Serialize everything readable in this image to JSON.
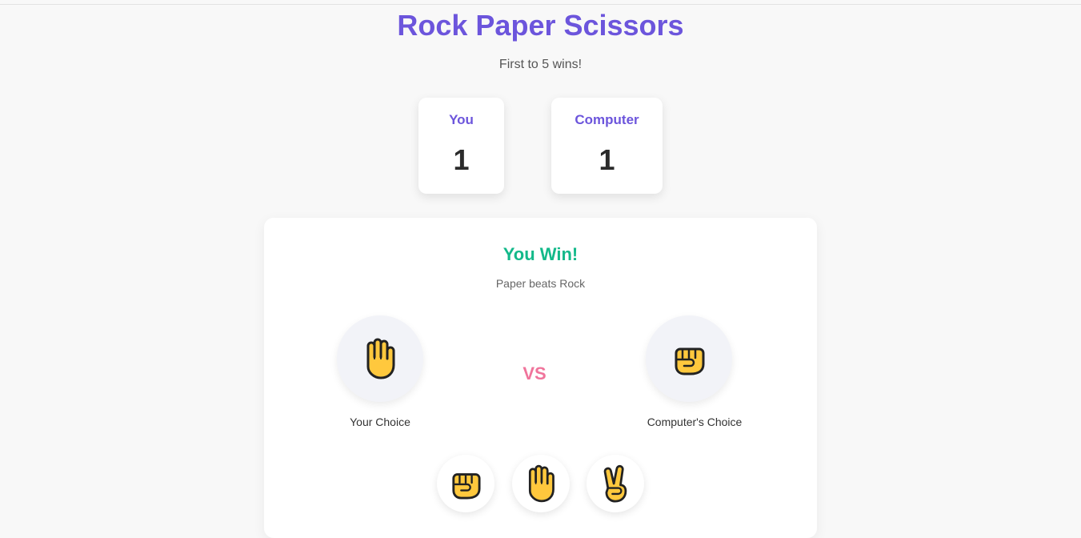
{
  "header": {
    "title": "Rock Paper Scissors",
    "subtitle": "First to 5 wins!"
  },
  "scoreboard": {
    "player": {
      "label": "You",
      "score": "1"
    },
    "computer": {
      "label": "Computer",
      "score": "1"
    }
  },
  "round": {
    "result": "You Win!",
    "detail": "Paper beats Rock",
    "player_choice": {
      "icon": "raised-hand-icon",
      "label": "Your Choice"
    },
    "vs_label": "VS",
    "computer_choice": {
      "icon": "raised-fist-icon",
      "label": "Computer's Choice"
    }
  },
  "controls": {
    "choices": [
      {
        "name": "rock",
        "icon": "raised-fist-icon"
      },
      {
        "name": "paper",
        "icon": "raised-hand-icon"
      },
      {
        "name": "scissors",
        "icon": "victory-hand-icon"
      }
    ]
  },
  "colors": {
    "accent": "#6c55dc",
    "win": "#13b98a",
    "vs": "#f0749b",
    "emoji_fill": "#ffc83d"
  }
}
